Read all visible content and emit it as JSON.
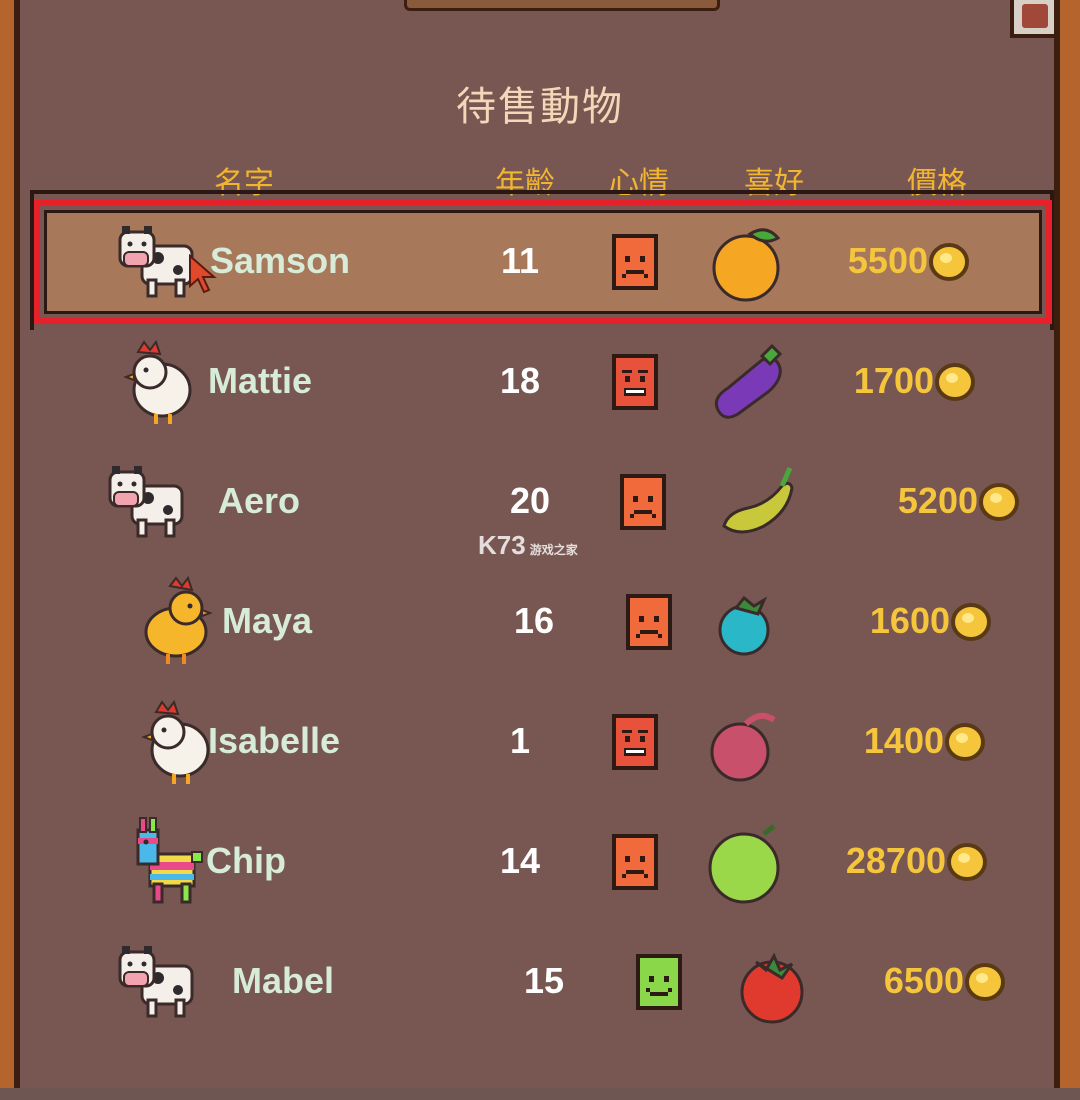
{
  "title": "待售動物",
  "headers": {
    "name": "名字",
    "age": "年齡",
    "mood": "心情",
    "favorite": "喜好",
    "price": "價格"
  },
  "watermark": {
    "brand": "K73",
    "sub": "游戏之家"
  },
  "animals": [
    {
      "name": "Samson",
      "age": "11",
      "price": "5500",
      "type": "cow-icon",
      "mood": "sad-face-icon",
      "favorite": "orange-icon",
      "selected": true
    },
    {
      "name": "Mattie",
      "age": "18",
      "price": "1700",
      "type": "chicken-icon",
      "mood": "angry-face-icon",
      "favorite": "eggplant-icon",
      "selected": false
    },
    {
      "name": "Aero",
      "age": "20",
      "price": "5200",
      "type": "cow-icon",
      "mood": "sad-face-icon",
      "favorite": "bean-pod-icon",
      "selected": false
    },
    {
      "name": "Maya",
      "age": "16",
      "price": "1600",
      "type": "chick-icon",
      "mood": "sad-face-icon",
      "favorite": "blueberry-icon",
      "selected": false
    },
    {
      "name": "Isabelle",
      "age": "1",
      "price": "1400",
      "type": "chicken-icon",
      "mood": "angry-face-icon",
      "favorite": "onion-icon",
      "selected": false
    },
    {
      "name": "Chip",
      "age": "14",
      "price": "28700",
      "type": "pinata-icon",
      "mood": "sad-face-icon",
      "favorite": "lime-icon",
      "selected": false
    },
    {
      "name": "Mabel",
      "age": "15",
      "price": "6500",
      "type": "cow-icon",
      "mood": "happy-face-icon",
      "favorite": "tomato-icon",
      "selected": false
    }
  ],
  "colors": {
    "frame": "#b5642e",
    "panel": "#785752",
    "highlight": "#e8202a",
    "price": "#f5c53c",
    "name": "#d6ecd9"
  }
}
